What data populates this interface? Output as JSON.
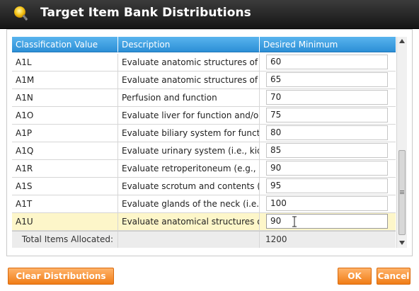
{
  "window": {
    "title": "Target Item Bank Distributions",
    "title_icon": "lightbulb-icon"
  },
  "grid": {
    "columns": [
      "Classification Value",
      "Description",
      "Desired Minimum"
    ],
    "rows": [
      {
        "classification": "A1L",
        "description": "Evaluate anatomic structures of the",
        "minimum": "60"
      },
      {
        "classification": "A1M",
        "description": "Evaluate anatomic structures of the",
        "minimum": "65"
      },
      {
        "classification": "A1N",
        "description": "Perfusion and function",
        "minimum": "70"
      },
      {
        "classification": "A1O",
        "description": "Evaluate liver for function and/or pe",
        "minimum": "75"
      },
      {
        "classification": "A1P",
        "description": "Evaluate biliary system for function a",
        "minimum": "80"
      },
      {
        "classification": "A1Q",
        "description": "Evaluate urinary system (i.e., kidneys",
        "minimum": "85"
      },
      {
        "classification": "A1R",
        "description": "Evaluate retroperitoneum (e.g., grea",
        "minimum": "90"
      },
      {
        "classification": "A1S",
        "description": "Evaluate scrotum and contents (i.e.,",
        "minimum": "95"
      },
      {
        "classification": "A1T",
        "description": "Evaluate glands of the neck (i.e., thy",
        "minimum": "100"
      },
      {
        "classification": "A1U",
        "description": "Evaluate anatomical structures of th",
        "minimum": "90"
      }
    ],
    "selected_row": 9,
    "footer": {
      "label": "Total Items Allocated:",
      "total": "1200"
    }
  },
  "buttons": {
    "clear": "Clear Distributions",
    "ok": "OK",
    "cancel": "Cancel"
  },
  "colors": {
    "header": "#2c8fd6",
    "selected_row": "#fdf6c9",
    "button": "#f07d17"
  }
}
